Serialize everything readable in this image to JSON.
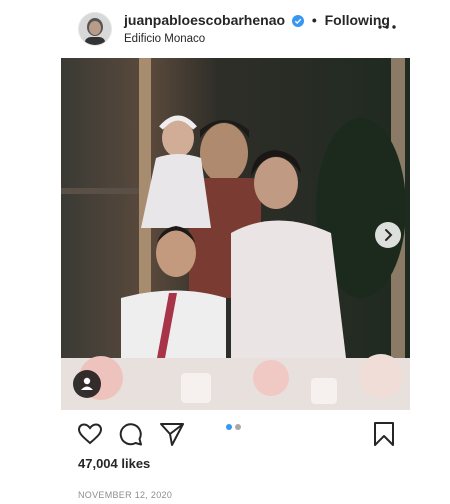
{
  "post": {
    "username": "juanpabloescobarhenao",
    "separator": "•",
    "follow_state": "Following",
    "location": "Edificio Monaco",
    "likes_text": "47,004 likes",
    "date": "NOVEMBER 12, 2020"
  },
  "carousel": {
    "total": 2,
    "active_index": 0,
    "active_color": "#3897f0",
    "inactive_color": "#a8a8a8"
  },
  "icons": {
    "verified": "verified-badge-icon",
    "more": "more-options-icon",
    "next": "chevron-right-icon",
    "tag": "user-tag-icon",
    "like": "heart-icon",
    "comment": "comment-icon",
    "share": "share-icon",
    "save": "bookmark-icon"
  },
  "colors": {
    "verified": "#3897f0",
    "text": "#262626",
    "muted": "#8e8e8e"
  }
}
